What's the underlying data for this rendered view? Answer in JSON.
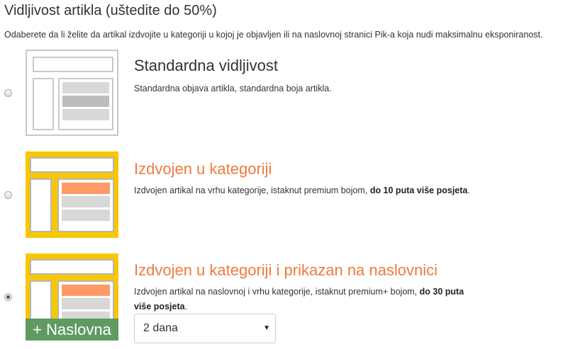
{
  "header": {
    "title": "Vidljivost artikla (uštedite do 50%)",
    "description": "Odaberete da li želite da artikal izdvojite u kategoriji u kojoj je objavljen ili na naslovnoj stranici Pik-a koja nudi maksimalnu eksponiranost."
  },
  "options": [
    {
      "title": "Standardna vidljivost",
      "description": "Standardna objava artikla, standardna boja artikla.",
      "selected": false
    },
    {
      "title": "Izdvojen u kategoriji",
      "description": "Izdvojen artikal na vrhu kategorije, istaknut premium bojom,",
      "emphasis": "do 10 puta više posjeta",
      "suffix": ".",
      "selected": false
    },
    {
      "title": "Izdvojen u kategoriji i prikazan na naslovnici",
      "description": "Izdvojen artikal na naslovnoj i vrhu kategorije, istaknut premium+ bojom,",
      "emphasis": "do 30 puta više posjeta",
      "suffix": ".",
      "badge": "+ Naslovna",
      "duration": {
        "selected": "2 dana"
      },
      "selected": true
    }
  ],
  "colors": {
    "accent_orange": "#f07a3e",
    "featured_yellow": "#f9c700",
    "badge_green": "#5e9a62"
  },
  "icons": {
    "select_arrow": "▼"
  }
}
